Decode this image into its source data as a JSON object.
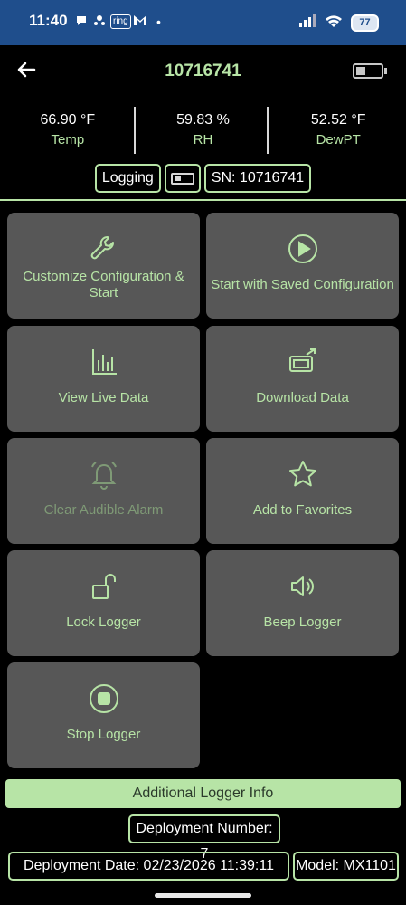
{
  "status_bar": {
    "time": "11:40",
    "notifications": [
      "chat-icon",
      "yelp-icon",
      "ring",
      "gmail-icon",
      "dot"
    ],
    "ring_label": "ring",
    "battery": "77"
  },
  "header": {
    "title": "10716741"
  },
  "readings": [
    {
      "value": "66.90 °F",
      "label": "Temp"
    },
    {
      "value": "59.83 %",
      "label": "RH"
    },
    {
      "value": "52.52 °F",
      "label": "DewPT"
    }
  ],
  "chips": {
    "status": "Logging",
    "serial": "SN: 10716741"
  },
  "actions": {
    "customize": "Customize Configuration & Start",
    "start_saved": "Start with Saved Configuration",
    "view_live": "View Live Data",
    "download": "Download Data",
    "clear_alarm": "Clear Audible Alarm",
    "favorites": "Add to Favorites",
    "lock": "Lock Logger",
    "beep": "Beep Logger",
    "stop": "Stop Logger"
  },
  "info": {
    "section_label": "Additional Logger Info",
    "deployment_number": "Deployment Number: 7",
    "deployment_date": "Deployment Date: 02/23/2026 11:39:11",
    "model": "Model: MX1101"
  },
  "colors": {
    "accent": "#b7e4a6",
    "tile": "#575757",
    "status_bar": "#1f4e8c",
    "background": "#000000"
  }
}
